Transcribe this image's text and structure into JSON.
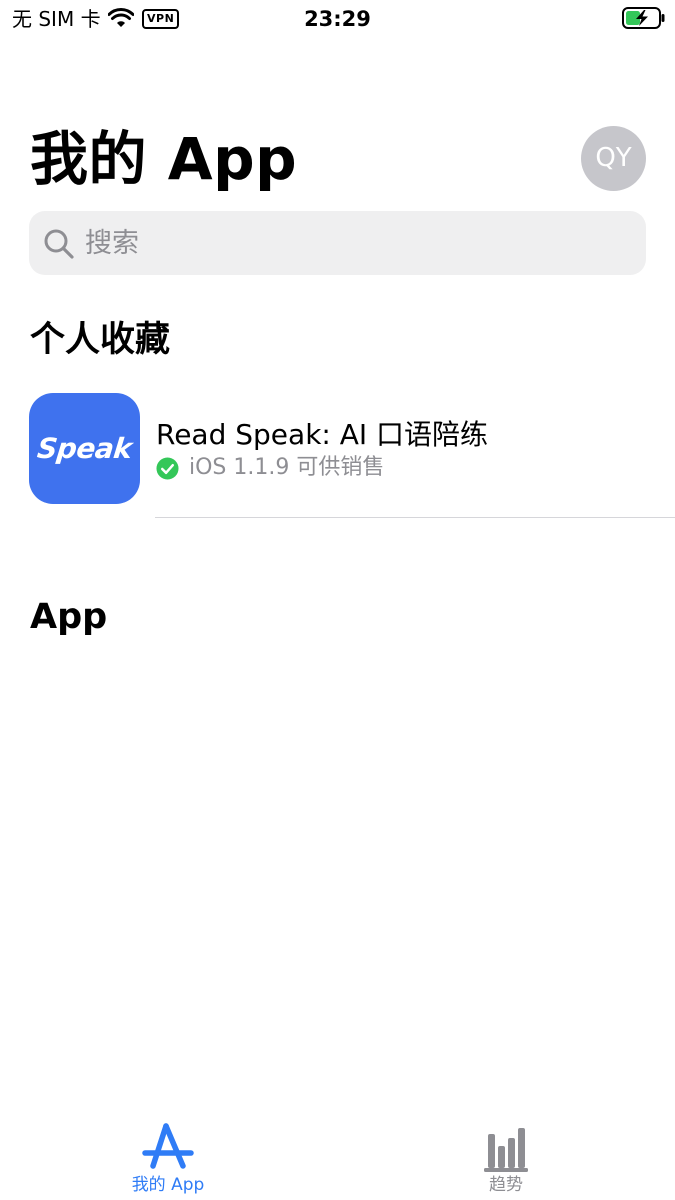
{
  "status_bar": {
    "carrier": "无 SIM 卡",
    "vpn_label": "VPN",
    "time": "23:29"
  },
  "header": {
    "title": "我的 App",
    "avatar_initials": "QY"
  },
  "search": {
    "placeholder": "搜索",
    "value": ""
  },
  "favorites": {
    "title": "个人收藏",
    "items": [
      {
        "icon_text": "Speak",
        "name": "Read Speak: AI 口语陪练",
        "status": "iOS 1.1.9 可供销售",
        "status_icon": "check-circle-icon"
      }
    ]
  },
  "apps_section": {
    "title": "App"
  },
  "tab_bar": {
    "tabs": [
      {
        "label": "我的 App",
        "icon": "app-store-icon",
        "active": true
      },
      {
        "label": "趋势",
        "icon": "bar-chart-icon",
        "active": false
      }
    ]
  },
  "colors": {
    "accent": "#2f7cf6",
    "app_icon_bg": "#3f72ee",
    "status_ok": "#34c759",
    "avatar_bg": "#c6c6cb",
    "search_bg": "#efeff0",
    "secondary_text": "#8e8e93",
    "tab_inactive": "#8e8e93"
  }
}
